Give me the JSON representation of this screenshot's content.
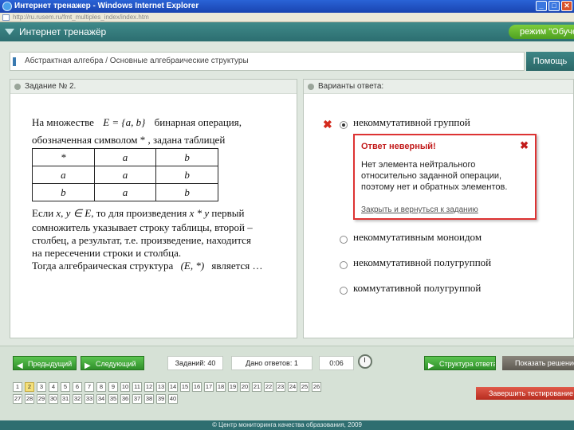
{
  "window": {
    "title": "Интернет тренажер - Windows Internet Explorer",
    "address": "http://ru.rusem.ru/fmt_multiples_index/index.htm",
    "buttons": [
      "_",
      "□",
      "✕"
    ]
  },
  "app": {
    "title": "Интернет тренажёр",
    "mode_button": "режим \"Обучение\""
  },
  "topic": {
    "text": "Абстрактная алгебра / Основные алгебраические структуры",
    "help_label": "Помощь"
  },
  "question_panel": {
    "header": "Задание № 2.",
    "lines": {
      "line1_a": "На множестве",
      "set_expr": "E = {a, b}",
      "line1_b": "бинарная операция,",
      "line2": "обозначенная символом * , задана таблицей",
      "line3_a": "Если",
      "line3_vars": "x, y ∈ E",
      "line3_b": ", то для произведения",
      "line3_prod": "x * y",
      "line3_c": "первый",
      "line4": "сомножитель указывает строку таблицы, второй –",
      "line5": "столбец, а результат, т.е. произведение, находится",
      "line6": "на пересечении строки и столбца.",
      "line7_a": "Тогда алгебраическая структура",
      "line7_struct": "(E, *)",
      "line7_b": "является …"
    },
    "table": [
      [
        "*",
        "a",
        "b"
      ],
      [
        "a",
        "a",
        "b"
      ],
      [
        "b",
        "a",
        "b"
      ]
    ]
  },
  "answers_panel": {
    "header": "Варианты ответа:",
    "options": [
      {
        "label": "некоммутативной группой",
        "selected": true
      },
      {
        "label": "некоммутативным моноидом",
        "selected": false
      },
      {
        "label": "некоммутативной полугруппой",
        "selected": false
      },
      {
        "label": "коммутативной полугруппой",
        "selected": false
      }
    ],
    "feedback": {
      "title": "Ответ неверный!",
      "body": "Нет элемента нейтрального относительно заданной операции, поэтому нет и обратных элементов.",
      "link": "Закрыть и вернуться к заданию"
    }
  },
  "bottom": {
    "prev_label": "Предыдущий",
    "next_label": "Следующий",
    "tasks_label": "Заданий: 40",
    "answered_label": "Дано ответов: 1",
    "time_label": "0:06",
    "answers_btn": "Структура ответа",
    "results_btn": "Показать решение",
    "finish_btn": "Завершить тестирование",
    "question_numbers": [
      "1",
      "2",
      "3",
      "4",
      "5",
      "6",
      "7",
      "8",
      "9",
      "10",
      "11",
      "12",
      "13",
      "14",
      "15",
      "16",
      "17",
      "18",
      "19",
      "20",
      "21",
      "22",
      "23",
      "24",
      "25",
      "26",
      "27",
      "28",
      "29",
      "30",
      "31",
      "32",
      "33",
      "34",
      "35",
      "36",
      "37",
      "38",
      "39",
      "40"
    ],
    "current": "2"
  },
  "footer": "© Центр мониторинга качества образования, 2009",
  "colors": {
    "teal": "#2e6e70",
    "green": "#4ea020",
    "error": "#c21b1b"
  }
}
